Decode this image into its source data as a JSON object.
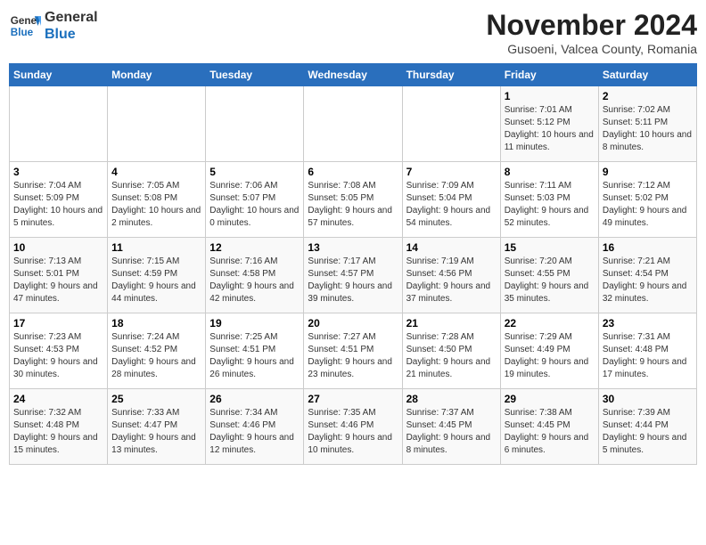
{
  "header": {
    "logo_general": "General",
    "logo_blue": "Blue",
    "month_title": "November 2024",
    "subtitle": "Gusoeni, Valcea County, Romania"
  },
  "weekdays": [
    "Sunday",
    "Monday",
    "Tuesday",
    "Wednesday",
    "Thursday",
    "Friday",
    "Saturday"
  ],
  "weeks": [
    [
      {
        "day": "",
        "info": ""
      },
      {
        "day": "",
        "info": ""
      },
      {
        "day": "",
        "info": ""
      },
      {
        "day": "",
        "info": ""
      },
      {
        "day": "",
        "info": ""
      },
      {
        "day": "1",
        "info": "Sunrise: 7:01 AM\nSunset: 5:12 PM\nDaylight: 10 hours and 11 minutes."
      },
      {
        "day": "2",
        "info": "Sunrise: 7:02 AM\nSunset: 5:11 PM\nDaylight: 10 hours and 8 minutes."
      }
    ],
    [
      {
        "day": "3",
        "info": "Sunrise: 7:04 AM\nSunset: 5:09 PM\nDaylight: 10 hours and 5 minutes."
      },
      {
        "day": "4",
        "info": "Sunrise: 7:05 AM\nSunset: 5:08 PM\nDaylight: 10 hours and 2 minutes."
      },
      {
        "day": "5",
        "info": "Sunrise: 7:06 AM\nSunset: 5:07 PM\nDaylight: 10 hours and 0 minutes."
      },
      {
        "day": "6",
        "info": "Sunrise: 7:08 AM\nSunset: 5:05 PM\nDaylight: 9 hours and 57 minutes."
      },
      {
        "day": "7",
        "info": "Sunrise: 7:09 AM\nSunset: 5:04 PM\nDaylight: 9 hours and 54 minutes."
      },
      {
        "day": "8",
        "info": "Sunrise: 7:11 AM\nSunset: 5:03 PM\nDaylight: 9 hours and 52 minutes."
      },
      {
        "day": "9",
        "info": "Sunrise: 7:12 AM\nSunset: 5:02 PM\nDaylight: 9 hours and 49 minutes."
      }
    ],
    [
      {
        "day": "10",
        "info": "Sunrise: 7:13 AM\nSunset: 5:01 PM\nDaylight: 9 hours and 47 minutes."
      },
      {
        "day": "11",
        "info": "Sunrise: 7:15 AM\nSunset: 4:59 PM\nDaylight: 9 hours and 44 minutes."
      },
      {
        "day": "12",
        "info": "Sunrise: 7:16 AM\nSunset: 4:58 PM\nDaylight: 9 hours and 42 minutes."
      },
      {
        "day": "13",
        "info": "Sunrise: 7:17 AM\nSunset: 4:57 PM\nDaylight: 9 hours and 39 minutes."
      },
      {
        "day": "14",
        "info": "Sunrise: 7:19 AM\nSunset: 4:56 PM\nDaylight: 9 hours and 37 minutes."
      },
      {
        "day": "15",
        "info": "Sunrise: 7:20 AM\nSunset: 4:55 PM\nDaylight: 9 hours and 35 minutes."
      },
      {
        "day": "16",
        "info": "Sunrise: 7:21 AM\nSunset: 4:54 PM\nDaylight: 9 hours and 32 minutes."
      }
    ],
    [
      {
        "day": "17",
        "info": "Sunrise: 7:23 AM\nSunset: 4:53 PM\nDaylight: 9 hours and 30 minutes."
      },
      {
        "day": "18",
        "info": "Sunrise: 7:24 AM\nSunset: 4:52 PM\nDaylight: 9 hours and 28 minutes."
      },
      {
        "day": "19",
        "info": "Sunrise: 7:25 AM\nSunset: 4:51 PM\nDaylight: 9 hours and 26 minutes."
      },
      {
        "day": "20",
        "info": "Sunrise: 7:27 AM\nSunset: 4:51 PM\nDaylight: 9 hours and 23 minutes."
      },
      {
        "day": "21",
        "info": "Sunrise: 7:28 AM\nSunset: 4:50 PM\nDaylight: 9 hours and 21 minutes."
      },
      {
        "day": "22",
        "info": "Sunrise: 7:29 AM\nSunset: 4:49 PM\nDaylight: 9 hours and 19 minutes."
      },
      {
        "day": "23",
        "info": "Sunrise: 7:31 AM\nSunset: 4:48 PM\nDaylight: 9 hours and 17 minutes."
      }
    ],
    [
      {
        "day": "24",
        "info": "Sunrise: 7:32 AM\nSunset: 4:48 PM\nDaylight: 9 hours and 15 minutes."
      },
      {
        "day": "25",
        "info": "Sunrise: 7:33 AM\nSunset: 4:47 PM\nDaylight: 9 hours and 13 minutes."
      },
      {
        "day": "26",
        "info": "Sunrise: 7:34 AM\nSunset: 4:46 PM\nDaylight: 9 hours and 12 minutes."
      },
      {
        "day": "27",
        "info": "Sunrise: 7:35 AM\nSunset: 4:46 PM\nDaylight: 9 hours and 10 minutes."
      },
      {
        "day": "28",
        "info": "Sunrise: 7:37 AM\nSunset: 4:45 PM\nDaylight: 9 hours and 8 minutes."
      },
      {
        "day": "29",
        "info": "Sunrise: 7:38 AM\nSunset: 4:45 PM\nDaylight: 9 hours and 6 minutes."
      },
      {
        "day": "30",
        "info": "Sunrise: 7:39 AM\nSunset: 4:44 PM\nDaylight: 9 hours and 5 minutes."
      }
    ]
  ]
}
